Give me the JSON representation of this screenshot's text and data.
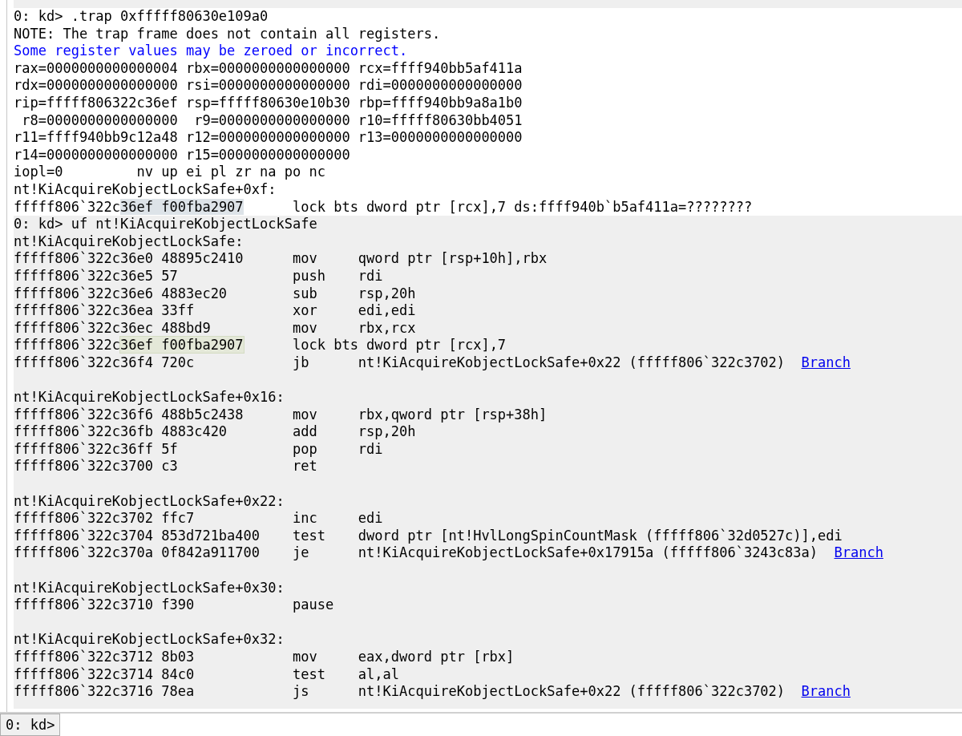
{
  "blocks": [
    {
      "shaded": false,
      "lines": [
        {
          "kind": "text",
          "segments": [
            {
              "text": "0: kd> .trap 0xfffff80630e109a0",
              "kind": "plain"
            }
          ]
        },
        {
          "kind": "text",
          "segments": [
            {
              "text": "NOTE: The trap frame does not contain all registers.",
              "kind": "plain"
            }
          ]
        },
        {
          "kind": "text",
          "segments": [
            {
              "text": "Some register values may be zeroed or incorrect.",
              "kind": "note"
            }
          ]
        },
        {
          "kind": "text",
          "segments": [
            {
              "text": "rax=0000000000000004 rbx=0000000000000000 rcx=ffff940bb5af411a",
              "kind": "plain"
            }
          ]
        },
        {
          "kind": "text",
          "segments": [
            {
              "text": "rdx=0000000000000000 rsi=0000000000000000 rdi=0000000000000000",
              "kind": "plain"
            }
          ]
        },
        {
          "kind": "text",
          "segments": [
            {
              "text": "rip=fffff806322c36ef rsp=fffff80630e10b30 rbp=ffff940bb9a8a1b0",
              "kind": "plain"
            }
          ]
        },
        {
          "kind": "text",
          "segments": [
            {
              "text": " r8=0000000000000000  r9=0000000000000000 r10=fffff80630bb4051",
              "kind": "plain"
            }
          ]
        },
        {
          "kind": "text",
          "segments": [
            {
              "text": "r11=ffff940bb9c12a48 r12=0000000000000000 r13=0000000000000000",
              "kind": "plain"
            }
          ]
        },
        {
          "kind": "text",
          "segments": [
            {
              "text": "r14=0000000000000000 r15=0000000000000000",
              "kind": "plain"
            }
          ]
        },
        {
          "kind": "text",
          "segments": [
            {
              "text": "iopl=0         nv up ei pl zr na po nc",
              "kind": "plain"
            }
          ]
        },
        {
          "kind": "text",
          "segments": [
            {
              "text": "nt!KiAcquireKobjectLockSafe+0xf:",
              "kind": "plain"
            }
          ]
        },
        {
          "kind": "text",
          "segments": [
            {
              "text": "fffff806`322c",
              "kind": "plain"
            },
            {
              "text": "36ef f00fba2907",
              "kind": "selection"
            },
            {
              "text": "      lock bts dword ptr [rcx],7 ds:ffff940b`b5af411a=????????",
              "kind": "plain"
            }
          ]
        }
      ]
    },
    {
      "shaded": true,
      "lines": [
        {
          "kind": "text",
          "segments": [
            {
              "text": "0: kd> uf nt!KiAcquireKobjectLockSafe",
              "kind": "plain"
            }
          ]
        },
        {
          "kind": "text",
          "segments": [
            {
              "text": "nt!KiAcquireKobjectLockSafe:",
              "kind": "plain"
            }
          ]
        },
        {
          "kind": "text",
          "segments": [
            {
              "text": "fffff806`322c36e0 48895c2410      mov     qword ptr [rsp+10h],rbx",
              "kind": "plain"
            }
          ]
        },
        {
          "kind": "text",
          "segments": [
            {
              "text": "fffff806`322c36e5 57              push    rdi",
              "kind": "plain"
            }
          ]
        },
        {
          "kind": "text",
          "segments": [
            {
              "text": "fffff806`322c36e6 4883ec20        sub     rsp,20h",
              "kind": "plain"
            }
          ]
        },
        {
          "kind": "text",
          "segments": [
            {
              "text": "fffff806`322c36ea 33ff            xor     edi,edi",
              "kind": "plain"
            }
          ]
        },
        {
          "kind": "text",
          "segments": [
            {
              "text": "fffff806`322c36ec 488bd9          mov     rbx,rcx",
              "kind": "plain"
            }
          ]
        },
        {
          "kind": "text",
          "segments": [
            {
              "text": "fffff806`322c",
              "kind": "plain"
            },
            {
              "text": "36ef f00fba2907",
              "kind": "match"
            },
            {
              "text": "      lock bts dword ptr [rcx],7",
              "kind": "plain"
            }
          ]
        },
        {
          "kind": "text",
          "segments": [
            {
              "text": "fffff806`322c36f4 720c            jb      nt!KiAcquireKobjectLockSafe+0x22 (fffff806`322c3702)",
              "kind": "plain"
            },
            {
              "text": "Branch",
              "kind": "link"
            }
          ]
        },
        {
          "kind": "blank"
        },
        {
          "kind": "text",
          "segments": [
            {
              "text": "nt!KiAcquireKobjectLockSafe+0x16:",
              "kind": "plain"
            }
          ]
        },
        {
          "kind": "text",
          "segments": [
            {
              "text": "fffff806`322c36f6 488b5c2438      mov     rbx,qword ptr [rsp+38h]",
              "kind": "plain"
            }
          ]
        },
        {
          "kind": "text",
          "segments": [
            {
              "text": "fffff806`322c36fb 4883c420        add     rsp,20h",
              "kind": "plain"
            }
          ]
        },
        {
          "kind": "text",
          "segments": [
            {
              "text": "fffff806`322c36ff 5f              pop     rdi",
              "kind": "plain"
            }
          ]
        },
        {
          "kind": "text",
          "segments": [
            {
              "text": "fffff806`322c3700 c3              ret",
              "kind": "plain"
            }
          ]
        },
        {
          "kind": "blank"
        },
        {
          "kind": "text",
          "segments": [
            {
              "text": "nt!KiAcquireKobjectLockSafe+0x22:",
              "kind": "plain"
            }
          ]
        },
        {
          "kind": "text",
          "segments": [
            {
              "text": "fffff806`322c3702 ffc7            inc     edi",
              "kind": "plain"
            }
          ]
        },
        {
          "kind": "text",
          "segments": [
            {
              "text": "fffff806`322c3704 853d721ba400    test    dword ptr [nt!HvlLongSpinCountMask (fffff806`32d0527c)],edi",
              "kind": "plain"
            }
          ]
        },
        {
          "kind": "text",
          "segments": [
            {
              "text": "fffff806`322c370a 0f842a911700    je      nt!KiAcquireKobjectLockSafe+0x17915a (fffff806`3243c83a)",
              "kind": "plain"
            },
            {
              "text": "Branch",
              "kind": "link"
            }
          ]
        },
        {
          "kind": "blank"
        },
        {
          "kind": "text",
          "segments": [
            {
              "text": "nt!KiAcquireKobjectLockSafe+0x30:",
              "kind": "plain"
            }
          ]
        },
        {
          "kind": "text",
          "segments": [
            {
              "text": "fffff806`322c3710 f390            pause",
              "kind": "plain"
            }
          ]
        },
        {
          "kind": "blank"
        },
        {
          "kind": "text",
          "segments": [
            {
              "text": "nt!KiAcquireKobjectLockSafe+0x32:",
              "kind": "plain"
            }
          ]
        },
        {
          "kind": "text",
          "segments": [
            {
              "text": "fffff806`322c3712 8b03            mov     eax,dword ptr [rbx]",
              "kind": "plain"
            }
          ]
        },
        {
          "kind": "text",
          "segments": [
            {
              "text": "fffff806`322c3714 84c0            test    al,al",
              "kind": "plain"
            }
          ]
        },
        {
          "kind": "text",
          "segments": [
            {
              "text": "fffff806`322c3716 78ea            js      nt!KiAcquireKobjectLockSafe+0x22 (fffff806`322c3702)",
              "kind": "plain"
            },
            {
              "text": "Branch",
              "kind": "link"
            }
          ]
        }
      ]
    }
  ],
  "command_bar": {
    "prompt": "0: kd>"
  }
}
